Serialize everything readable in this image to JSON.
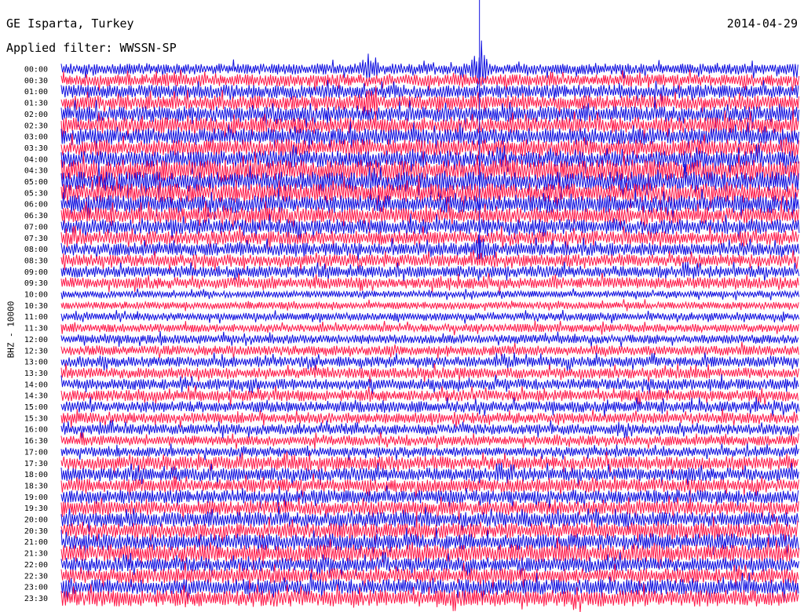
{
  "header": {
    "station": "GE Isparta, Turkey",
    "date": "2014-04-29",
    "filter": "Applied filter: WWSSN-SP"
  },
  "colors": {
    "trace_a": "#1010e0",
    "trace_b": "#ff1a4a",
    "background": "#ffffff"
  },
  "chart_data": {
    "type": "line",
    "subtype": "helicorder",
    "ylabel": "BHZ - 10000",
    "row_labels": [
      "00:00",
      "00:30",
      "01:00",
      "01:30",
      "02:00",
      "02:30",
      "03:00",
      "03:30",
      "04:00",
      "04:30",
      "05:00",
      "05:30",
      "06:00",
      "06:30",
      "07:00",
      "07:30",
      "08:00",
      "08:30",
      "09:00",
      "09:30",
      "10:00",
      "10:30",
      "11:00",
      "11:30",
      "12:00",
      "12:30",
      "13:00",
      "13:30",
      "14:00",
      "14:30",
      "15:00",
      "15:30",
      "16:00",
      "16:30",
      "17:00",
      "17:30",
      "18:00",
      "18:30",
      "19:00",
      "19:30",
      "20:00",
      "20:30",
      "21:00",
      "21:30",
      "22:00",
      "22:30",
      "23:00",
      "23:30"
    ],
    "minutes_per_row": 30,
    "color_cycle": [
      "blue",
      "red"
    ],
    "notable_events": [
      {
        "row_label": "00:00",
        "minute": 12.5,
        "relative_amplitude": 1.9
      },
      {
        "row_label": "01:30",
        "minute": 12.5,
        "relative_amplitude": 1.5
      },
      {
        "row_label": "00:00",
        "minute": 17.0,
        "relative_amplitude": 3.0
      },
      {
        "row_label": "08:00",
        "minute": 17.0,
        "relative_amplitude": 1.4
      }
    ],
    "grid": false,
    "legend": "none"
  }
}
